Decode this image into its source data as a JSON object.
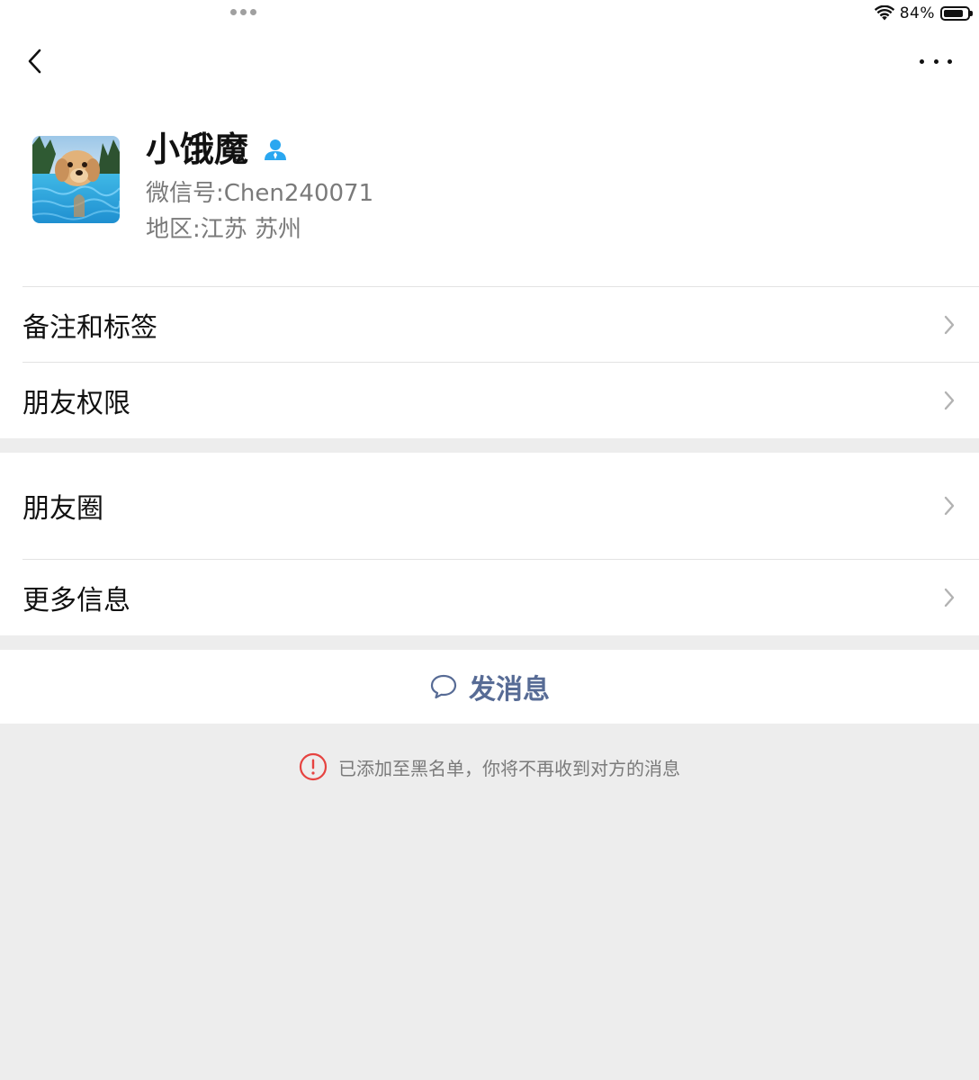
{
  "status_bar": {
    "battery_percent": "84%",
    "battery_level": 0.84,
    "wifi_icon": "wifi-icon",
    "multitask_icon": "more-dots-icon"
  },
  "nav": {
    "back_icon": "chevron-left-icon",
    "more_icon": "ellipsis-icon"
  },
  "profile": {
    "nickname": "小饿魔",
    "contact_icon": "contact-person-icon",
    "wechat_id_label": "微信号:",
    "wechat_id": "Chen240071",
    "region_label": "地区:",
    "region": "江苏 苏州",
    "avatar": "dog-swimming-avatar"
  },
  "menu": {
    "remarks_tags": "备注和标签",
    "friend_permissions": "朋友权限",
    "moments": "朋友圈",
    "more_info": "更多信息"
  },
  "actions": {
    "send_message": "发消息",
    "send_message_icon": "chat-bubble-icon"
  },
  "notice": {
    "text": "已添加至黑名单，你将不再收到对方的消息",
    "icon": "warning-circle-icon",
    "icon_color": "#e64340"
  },
  "colors": {
    "link_blue": "#576b95",
    "contact_icon_blue": "#2aa7f0"
  }
}
